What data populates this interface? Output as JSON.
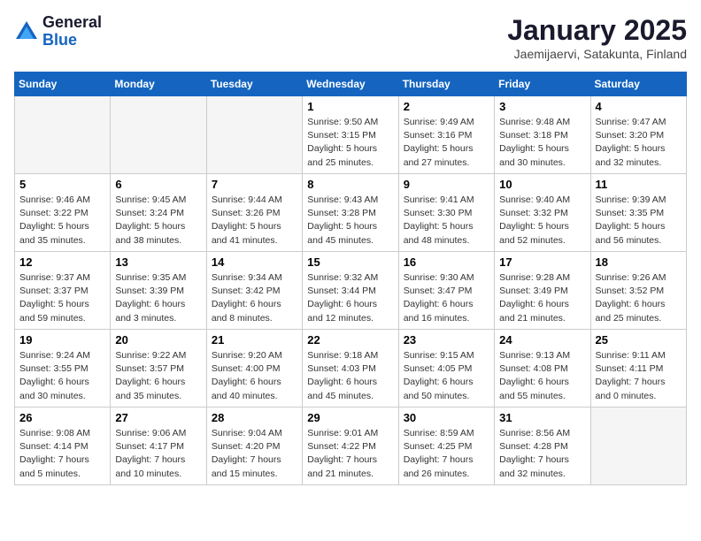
{
  "logo": {
    "general": "General",
    "blue": "Blue"
  },
  "header": {
    "title": "January 2025",
    "location": "Jaemijaervi, Satakunta, Finland"
  },
  "weekdays": [
    "Sunday",
    "Monday",
    "Tuesday",
    "Wednesday",
    "Thursday",
    "Friday",
    "Saturday"
  ],
  "weeks": [
    [
      {
        "day": "",
        "info": ""
      },
      {
        "day": "",
        "info": ""
      },
      {
        "day": "",
        "info": ""
      },
      {
        "day": "1",
        "info": "Sunrise: 9:50 AM\nSunset: 3:15 PM\nDaylight: 5 hours and 25 minutes."
      },
      {
        "day": "2",
        "info": "Sunrise: 9:49 AM\nSunset: 3:16 PM\nDaylight: 5 hours and 27 minutes."
      },
      {
        "day": "3",
        "info": "Sunrise: 9:48 AM\nSunset: 3:18 PM\nDaylight: 5 hours and 30 minutes."
      },
      {
        "day": "4",
        "info": "Sunrise: 9:47 AM\nSunset: 3:20 PM\nDaylight: 5 hours and 32 minutes."
      }
    ],
    [
      {
        "day": "5",
        "info": "Sunrise: 9:46 AM\nSunset: 3:22 PM\nDaylight: 5 hours and 35 minutes."
      },
      {
        "day": "6",
        "info": "Sunrise: 9:45 AM\nSunset: 3:24 PM\nDaylight: 5 hours and 38 minutes."
      },
      {
        "day": "7",
        "info": "Sunrise: 9:44 AM\nSunset: 3:26 PM\nDaylight: 5 hours and 41 minutes."
      },
      {
        "day": "8",
        "info": "Sunrise: 9:43 AM\nSunset: 3:28 PM\nDaylight: 5 hours and 45 minutes."
      },
      {
        "day": "9",
        "info": "Sunrise: 9:41 AM\nSunset: 3:30 PM\nDaylight: 5 hours and 48 minutes."
      },
      {
        "day": "10",
        "info": "Sunrise: 9:40 AM\nSunset: 3:32 PM\nDaylight: 5 hours and 52 minutes."
      },
      {
        "day": "11",
        "info": "Sunrise: 9:39 AM\nSunset: 3:35 PM\nDaylight: 5 hours and 56 minutes."
      }
    ],
    [
      {
        "day": "12",
        "info": "Sunrise: 9:37 AM\nSunset: 3:37 PM\nDaylight: 5 hours and 59 minutes."
      },
      {
        "day": "13",
        "info": "Sunrise: 9:35 AM\nSunset: 3:39 PM\nDaylight: 6 hours and 3 minutes."
      },
      {
        "day": "14",
        "info": "Sunrise: 9:34 AM\nSunset: 3:42 PM\nDaylight: 6 hours and 8 minutes."
      },
      {
        "day": "15",
        "info": "Sunrise: 9:32 AM\nSunset: 3:44 PM\nDaylight: 6 hours and 12 minutes."
      },
      {
        "day": "16",
        "info": "Sunrise: 9:30 AM\nSunset: 3:47 PM\nDaylight: 6 hours and 16 minutes."
      },
      {
        "day": "17",
        "info": "Sunrise: 9:28 AM\nSunset: 3:49 PM\nDaylight: 6 hours and 21 minutes."
      },
      {
        "day": "18",
        "info": "Sunrise: 9:26 AM\nSunset: 3:52 PM\nDaylight: 6 hours and 25 minutes."
      }
    ],
    [
      {
        "day": "19",
        "info": "Sunrise: 9:24 AM\nSunset: 3:55 PM\nDaylight: 6 hours and 30 minutes."
      },
      {
        "day": "20",
        "info": "Sunrise: 9:22 AM\nSunset: 3:57 PM\nDaylight: 6 hours and 35 minutes."
      },
      {
        "day": "21",
        "info": "Sunrise: 9:20 AM\nSunset: 4:00 PM\nDaylight: 6 hours and 40 minutes."
      },
      {
        "day": "22",
        "info": "Sunrise: 9:18 AM\nSunset: 4:03 PM\nDaylight: 6 hours and 45 minutes."
      },
      {
        "day": "23",
        "info": "Sunrise: 9:15 AM\nSunset: 4:05 PM\nDaylight: 6 hours and 50 minutes."
      },
      {
        "day": "24",
        "info": "Sunrise: 9:13 AM\nSunset: 4:08 PM\nDaylight: 6 hours and 55 minutes."
      },
      {
        "day": "25",
        "info": "Sunrise: 9:11 AM\nSunset: 4:11 PM\nDaylight: 7 hours and 0 minutes."
      }
    ],
    [
      {
        "day": "26",
        "info": "Sunrise: 9:08 AM\nSunset: 4:14 PM\nDaylight: 7 hours and 5 minutes."
      },
      {
        "day": "27",
        "info": "Sunrise: 9:06 AM\nSunset: 4:17 PM\nDaylight: 7 hours and 10 minutes."
      },
      {
        "day": "28",
        "info": "Sunrise: 9:04 AM\nSunset: 4:20 PM\nDaylight: 7 hours and 15 minutes."
      },
      {
        "day": "29",
        "info": "Sunrise: 9:01 AM\nSunset: 4:22 PM\nDaylight: 7 hours and 21 minutes."
      },
      {
        "day": "30",
        "info": "Sunrise: 8:59 AM\nSunset: 4:25 PM\nDaylight: 7 hours and 26 minutes."
      },
      {
        "day": "31",
        "info": "Sunrise: 8:56 AM\nSunset: 4:28 PM\nDaylight: 7 hours and 32 minutes."
      },
      {
        "day": "",
        "info": ""
      }
    ]
  ]
}
